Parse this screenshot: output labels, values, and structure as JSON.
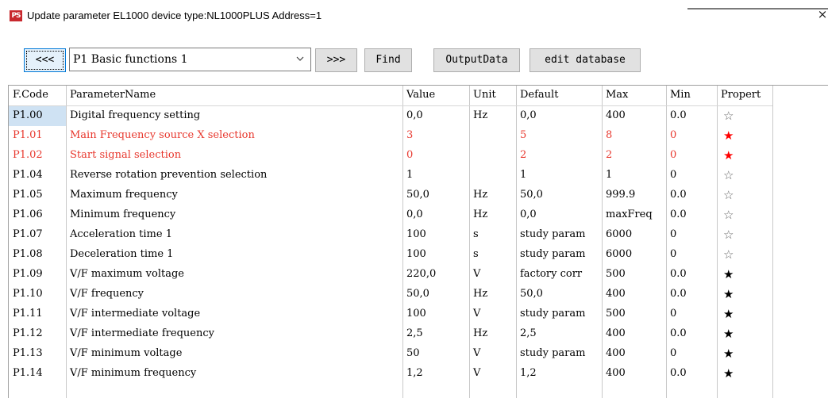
{
  "window": {
    "icon_text": "PS",
    "title": "Update parameter EL1000 device type:NL1000PLUS  Address=1",
    "close_glyph": "×"
  },
  "toolbar": {
    "prev_label": "<<<",
    "group_selected": "P1 Basic functions 1",
    "next_label": ">>>",
    "find_label": "Find",
    "output_label": "OutputData",
    "editdb_label": "edit database"
  },
  "table": {
    "headers": [
      "F.Code",
      "ParameterName",
      "Value",
      "Unit",
      "Default",
      "Max",
      "Min",
      "Propert"
    ],
    "rows": [
      {
        "code": "P1.00",
        "name": "Digital frequency setting",
        "value": "0,0",
        "unit": "Hz",
        "default": "0,0",
        "max": "400",
        "min": "0.0",
        "prop": "☆",
        "highlight": false,
        "selected": true,
        "solid": false
      },
      {
        "code": "P1.01",
        "name": "Main Frequency source X selection",
        "value": "3",
        "unit": "",
        "default": "5",
        "max": "8",
        "min": "0",
        "prop": "★",
        "highlight": true,
        "selected": false,
        "solid": true
      },
      {
        "code": "P1.02",
        "name": "Start signal selection",
        "value": "0",
        "unit": "",
        "default": "2",
        "max": "2",
        "min": "0",
        "prop": "★",
        "highlight": true,
        "selected": false,
        "solid": true
      },
      {
        "code": "P1.04",
        "name": "Reverse rotation prevention selection",
        "value": "1",
        "unit": "",
        "default": "1",
        "max": "1",
        "min": "0",
        "prop": "☆",
        "highlight": false,
        "selected": false,
        "solid": false
      },
      {
        "code": "P1.05",
        "name": "Maximum frequency",
        "value": "50,0",
        "unit": "Hz",
        "default": "50,0",
        "max": "999.9",
        "min": "0.0",
        "prop": "☆",
        "highlight": false,
        "selected": false,
        "solid": false
      },
      {
        "code": "P1.06",
        "name": "Minimum frequency",
        "value": "0,0",
        "unit": "Hz",
        "default": "0,0",
        "max": "maxFreq",
        "min": "0.0",
        "prop": "☆",
        "highlight": false,
        "selected": false,
        "solid": false
      },
      {
        "code": "P1.07",
        "name": "Acceleration time 1",
        "value": "100",
        "unit": "s",
        "default": "study param",
        "max": "6000",
        "min": "0",
        "prop": "☆",
        "highlight": false,
        "selected": false,
        "solid": false
      },
      {
        "code": "P1.08",
        "name": "Deceleration time 1",
        "value": "100",
        "unit": "s",
        "default": "study param",
        "max": "6000",
        "min": "0",
        "prop": "☆",
        "highlight": false,
        "selected": false,
        "solid": false
      },
      {
        "code": "P1.09",
        "name": "V/F maximum voltage",
        "value": "220,0",
        "unit": "V",
        "default": "factory corr",
        "max": "500",
        "min": "0.0",
        "prop": "★",
        "highlight": false,
        "selected": false,
        "solid": true
      },
      {
        "code": "P1.10",
        "name": "V/F frequency",
        "value": "50,0",
        "unit": "Hz",
        "default": "50,0",
        "max": "400",
        "min": "0.0",
        "prop": "★",
        "highlight": false,
        "selected": false,
        "solid": true
      },
      {
        "code": "P1.11",
        "name": "V/F intermediate voltage",
        "value": "100",
        "unit": "V",
        "default": "study param",
        "max": "500",
        "min": "0",
        "prop": "★",
        "highlight": false,
        "selected": false,
        "solid": true
      },
      {
        "code": "P1.12",
        "name": "V/F intermediate frequency",
        "value": "2,5",
        "unit": "Hz",
        "default": "2,5",
        "max": "400",
        "min": "0.0",
        "prop": "★",
        "highlight": false,
        "selected": false,
        "solid": true
      },
      {
        "code": "P1.13",
        "name": "V/F minimum voltage",
        "value": "50",
        "unit": "V",
        "default": "study param",
        "max": "400",
        "min": "0",
        "prop": "★",
        "highlight": false,
        "selected": false,
        "solid": true
      },
      {
        "code": "P1.14",
        "name": "V/F minimum frequency",
        "value": "1,2",
        "unit": "V",
        "default": "1,2",
        "max": "400",
        "min": "0.0",
        "prop": "★",
        "highlight": false,
        "selected": false,
        "solid": true
      }
    ]
  },
  "colors": {
    "highlight_text": "#e8382e",
    "selected_cell_bg": "#cfe2f3",
    "focus_border": "#0078d7"
  }
}
